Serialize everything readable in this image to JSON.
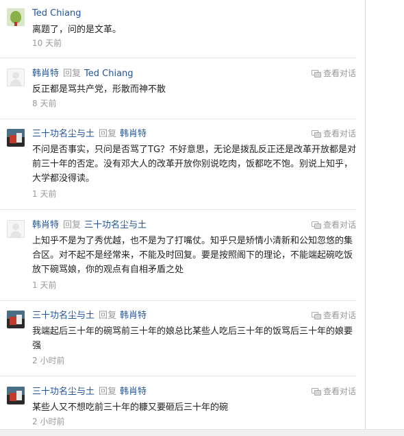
{
  "comments": [
    {
      "author": "Ted Chiang",
      "reply_word": "",
      "reply_to": "",
      "text": "离题了，问的是文革。",
      "time": "10 天前",
      "view_conversation": "",
      "avatar_icon": "ted-chiang-avatar"
    },
    {
      "author": "韩肖特",
      "reply_word": "回复",
      "reply_to": "Ted Chiang",
      "text": "反正都是骂共产党，形散而神不散",
      "time": "8 天前",
      "view_conversation": "查看对话",
      "avatar_icon": "default-avatar"
    },
    {
      "author": "三十功名尘与土",
      "reply_word": "回复",
      "reply_to": "韩肖特",
      "text": "不问是否事实，只问是否骂了TG？不好意思，无论是拨乱反正还是改革开放都是对前三十年的否定。没有邓大人的改革开放你别说吃肉，饭都吃不饱。别说上知乎，大学都没得读。",
      "time": "1 天前",
      "view_conversation": "查看对话",
      "avatar_icon": "photo-avatar"
    },
    {
      "author": "韩肖特",
      "reply_word": "回复",
      "reply_to": "三十功名尘与土",
      "text": "上知乎不是为了秀优越，也不是为了打嘴仗。知乎只是矫情小清新和公知忽悠的集合区。对不起不是经常来，不能及时回复。要是按照阁下的理论，不能端起碗吃饭放下碗骂娘，你的观点有自相矛盾之处",
      "time": "1 天前",
      "view_conversation": "查看对话",
      "avatar_icon": "default-avatar"
    },
    {
      "author": "三十功名尘与土",
      "reply_word": "回复",
      "reply_to": "韩肖特",
      "text": "我端起后三十年的碗骂前三十年的娘总比某些人吃后三十年的饭骂后三十年的娘要强",
      "time": "2 小时前",
      "view_conversation": "查看对话",
      "avatar_icon": "photo-avatar"
    },
    {
      "author": "三十功名尘与土",
      "reply_word": "回复",
      "reply_to": "韩肖特",
      "text": "某些人又不想吃前三十年的糠又要砸后三十年的碗",
      "time": "2 小时前",
      "view_conversation": "查看对话",
      "avatar_icon": "photo-avatar"
    }
  ]
}
